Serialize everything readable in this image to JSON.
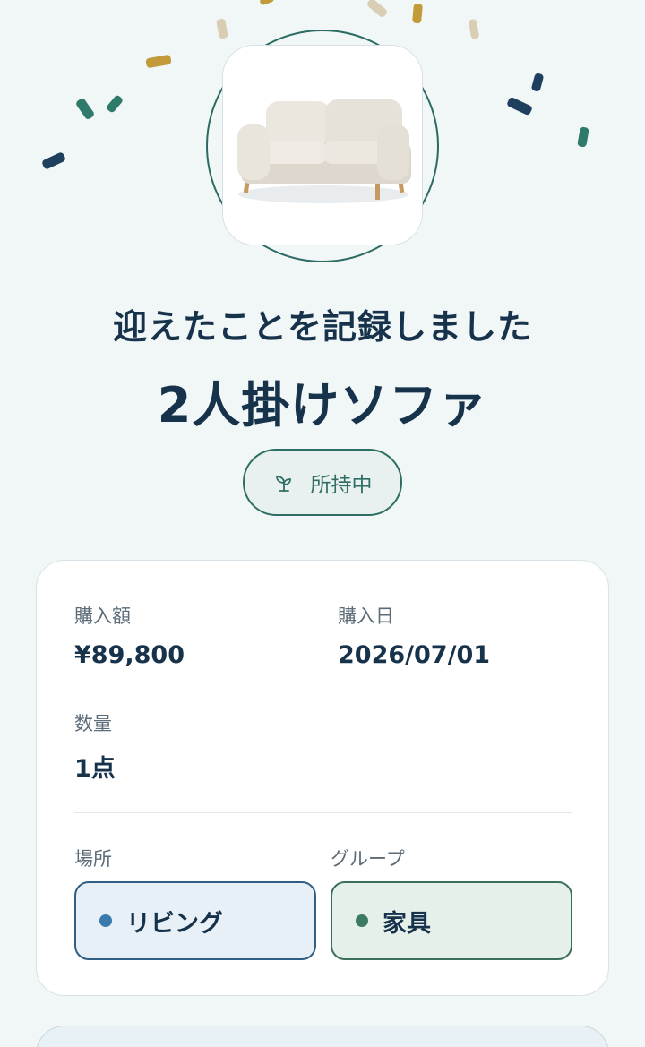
{
  "celebration": {
    "headline": "迎えたことを記録しました",
    "item_name": "2人掛けソファ",
    "photo_icon": "sofa-illustration"
  },
  "status": {
    "label": "所持中",
    "icon": "sprout-icon",
    "color": "#2e6e64"
  },
  "details": {
    "price_label": "購入額",
    "price_value": "¥89,800",
    "date_label": "購入日",
    "date_value": "2026/07/01",
    "quantity_label": "数量",
    "quantity_value": "1点",
    "place_label": "場所",
    "place_value": "リビング",
    "place_color": "#3a7bad",
    "group_label": "グループ",
    "group_value": "家具",
    "group_color": "#3c7a62"
  },
  "confetti_colors": [
    "#1e3f5e",
    "#2f7a6a",
    "#c29a3a",
    "#d9cdb4"
  ]
}
